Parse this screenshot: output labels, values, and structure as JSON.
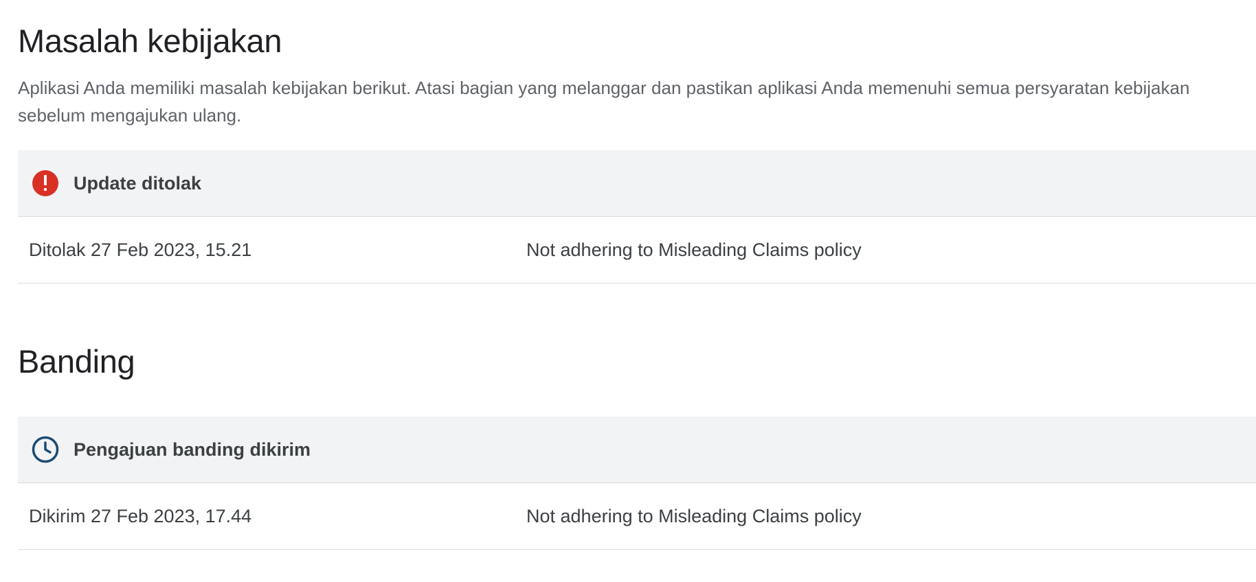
{
  "policy_section": {
    "title": "Masalah kebijakan",
    "description": "Aplikasi Anda memiliki masalah kebijakan berikut. Atasi bagian yang melanggar dan pastikan aplikasi Anda memenuhi semua persyaratan kebijakan sebelum mengajukan ulang.",
    "status": {
      "icon": "error-icon",
      "icon_color": "#d93025",
      "label": "Update ditolak"
    },
    "rows": [
      {
        "date": "Ditolak 27 Feb 2023, 15.21",
        "reason": "Not adhering to Misleading Claims policy"
      }
    ]
  },
  "appeal_section": {
    "title": "Banding",
    "status": {
      "icon": "clock-icon",
      "icon_color": "#1a4b73",
      "label": "Pengajuan banding dikirim"
    },
    "rows": [
      {
        "date": "Dikirim 27 Feb 2023, 17.44",
        "reason": "Not adhering to Misleading Claims policy"
      }
    ]
  }
}
